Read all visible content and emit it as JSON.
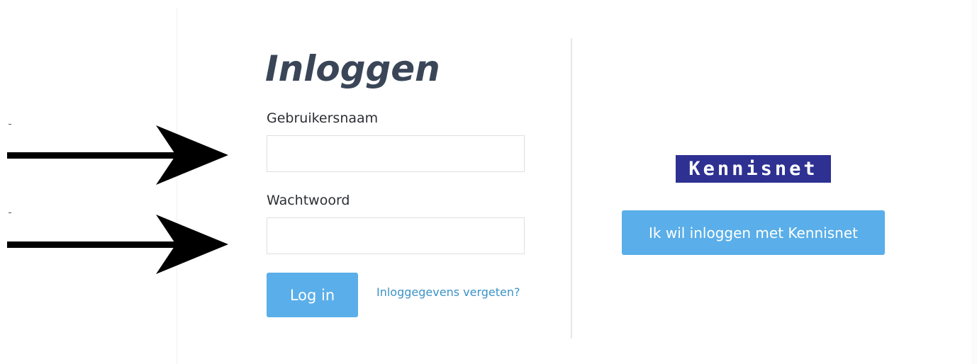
{
  "login": {
    "title": "Inloggen",
    "username_label": "Gebruikersnaam",
    "username_value": "",
    "password_label": "Wachtwoord",
    "password_value": "",
    "login_button": "Log in",
    "forgot_link": "Inloggegevens vergeten?"
  },
  "kennisnet": {
    "logo_text": "Kennisnet",
    "button": "Ik wil inloggen met Kennisnet"
  },
  "annotations": {
    "arrow_icon": "right-arrow-icon"
  },
  "colors": {
    "button_blue": "#5aaee9",
    "link_blue": "#3b93c7",
    "title_slate": "#3a4658",
    "kennisnet_navy": "#2e3192"
  }
}
